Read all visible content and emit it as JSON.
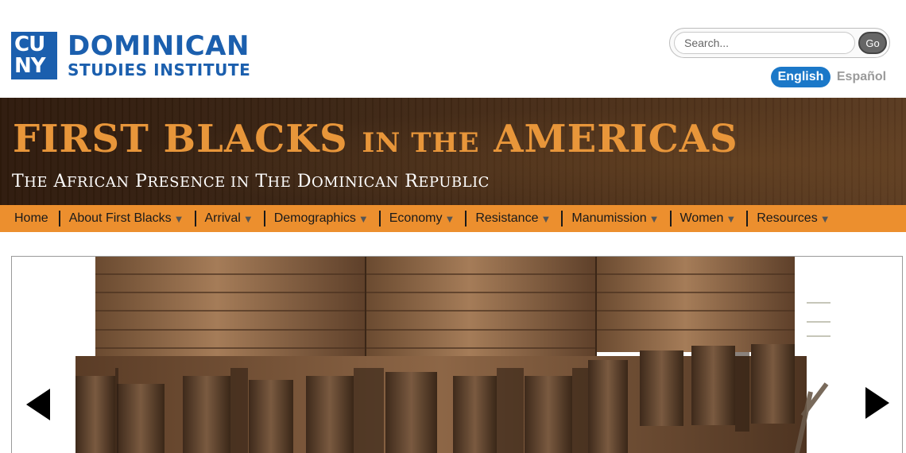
{
  "logo": {
    "cuny_line1": "CU",
    "cuny_line2": "NY",
    "name_line1": "DOMINICAN",
    "name_line2": "STUDIES INSTITUTE",
    "brand_color": "#1b5fae"
  },
  "search": {
    "placeholder": "Search...",
    "value": "",
    "go_label": "Go"
  },
  "language": {
    "english": "English",
    "espanol": "Español",
    "active": "English",
    "active_color": "#1b78c8"
  },
  "banner": {
    "title_part1": "FIRST BLACKS",
    "title_part2": "IN THE",
    "title_part3": "AMERICAS",
    "subtitle_1": "T",
    "subtitle_2": "HE",
    "subtitle_3": "A",
    "subtitle_4": "FRICAN",
    "subtitle_5": "P",
    "subtitle_6": "RESENCE IN",
    "subtitle_7": "T",
    "subtitle_8": "HE",
    "subtitle_9": "D",
    "subtitle_10": "OMINICAN",
    "subtitle_11": "R",
    "subtitle_12": "EPUBLIC",
    "title_color": "#e8963a"
  },
  "nav": {
    "background": "#ec8f2e",
    "caret": "▼",
    "items": [
      {
        "label": "Home"
      },
      {
        "label": "About First Blacks"
      },
      {
        "label": "Arrival"
      },
      {
        "label": "Demographics"
      },
      {
        "label": "Economy"
      },
      {
        "label": "Resistance"
      },
      {
        "label": "Manumission"
      },
      {
        "label": "Women"
      },
      {
        "label": "Resources"
      }
    ]
  },
  "slider": {
    "prev_icon": "arrow-left-icon",
    "next_icon": "arrow-right-icon"
  }
}
